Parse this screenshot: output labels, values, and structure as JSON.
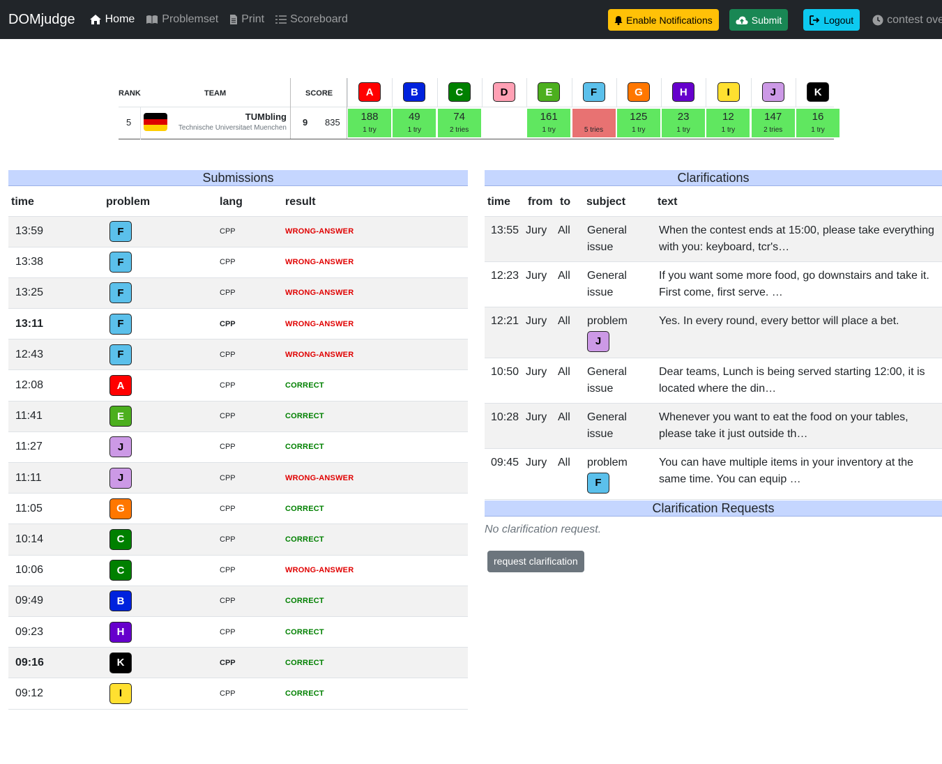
{
  "nav": {
    "brand": "DOMjudge",
    "home": "Home",
    "problemset": "Problemset",
    "print": "Print",
    "scoreboard": "Scoreboard",
    "enable_notifications": "Enable Notifications",
    "submit": "Submit",
    "logout": "Logout",
    "contest_status": "contest over"
  },
  "scoreboard": {
    "headers": {
      "rank": "RANK",
      "team": "TEAM",
      "score": "SCORE"
    },
    "problems": [
      {
        "label": "A",
        "color": "#ff0000",
        "text": "#ffffff"
      },
      {
        "label": "B",
        "color": "#0022dd",
        "text": "#ffffff"
      },
      {
        "label": "C",
        "color": "#008000",
        "text": "#ffffff"
      },
      {
        "label": "D",
        "color": "#ffa0b4",
        "text": "#000000"
      },
      {
        "label": "E",
        "color": "#4caf1e",
        "text": "#ffffff"
      },
      {
        "label": "F",
        "color": "#5bc0eb",
        "text": "#000000"
      },
      {
        "label": "G",
        "color": "#ff7700",
        "text": "#ffffff"
      },
      {
        "label": "H",
        "color": "#6600cc",
        "text": "#ffffff"
      },
      {
        "label": "I",
        "color": "#ffe030",
        "text": "#000000"
      },
      {
        "label": "J",
        "color": "#cc99e6",
        "text": "#000000"
      },
      {
        "label": "K",
        "color": "#000000",
        "text": "#ffffff"
      }
    ],
    "team": {
      "rank": "5",
      "name": "TUMbling",
      "affiliation": "Technische Universitaet Muenchen",
      "solved": "9",
      "penalty": "835",
      "results": [
        {
          "status": "solved",
          "points": "188",
          "tries": "1 try"
        },
        {
          "status": "solved",
          "points": "49",
          "tries": "1 try"
        },
        {
          "status": "solved",
          "points": "74",
          "tries": "2 tries"
        },
        {
          "status": "none",
          "points": "",
          "tries": ""
        },
        {
          "status": "solved",
          "points": "161",
          "tries": "1 try"
        },
        {
          "status": "wrong",
          "points": "",
          "tries": "5 tries"
        },
        {
          "status": "solved",
          "points": "125",
          "tries": "1 try"
        },
        {
          "status": "solved",
          "points": "23",
          "tries": "1 try"
        },
        {
          "status": "solved",
          "points": "12",
          "tries": "1 try"
        },
        {
          "status": "solved",
          "points": "147",
          "tries": "2 tries"
        },
        {
          "status": "solved",
          "points": "16",
          "tries": "1 try"
        }
      ]
    }
  },
  "submissions": {
    "title": "Submissions",
    "headers": {
      "time": "time",
      "problem": "problem",
      "lang": "lang",
      "result": "result"
    },
    "rows": [
      {
        "time": "13:59",
        "problem": "F",
        "lang": "CPP",
        "result": "WRONG-ANSWER",
        "bold": false
      },
      {
        "time": "13:38",
        "problem": "F",
        "lang": "CPP",
        "result": "WRONG-ANSWER",
        "bold": false
      },
      {
        "time": "13:25",
        "problem": "F",
        "lang": "CPP",
        "result": "WRONG-ANSWER",
        "bold": false
      },
      {
        "time": "13:11",
        "problem": "F",
        "lang": "CPP",
        "result": "WRONG-ANSWER",
        "bold": true
      },
      {
        "time": "12:43",
        "problem": "F",
        "lang": "CPP",
        "result": "WRONG-ANSWER",
        "bold": false
      },
      {
        "time": "12:08",
        "problem": "A",
        "lang": "CPP",
        "result": "CORRECT",
        "bold": false
      },
      {
        "time": "11:41",
        "problem": "E",
        "lang": "CPP",
        "result": "CORRECT",
        "bold": false
      },
      {
        "time": "11:27",
        "problem": "J",
        "lang": "CPP",
        "result": "CORRECT",
        "bold": false
      },
      {
        "time": "11:11",
        "problem": "J",
        "lang": "CPP",
        "result": "WRONG-ANSWER",
        "bold": false
      },
      {
        "time": "11:05",
        "problem": "G",
        "lang": "CPP",
        "result": "CORRECT",
        "bold": false
      },
      {
        "time": "10:14",
        "problem": "C",
        "lang": "CPP",
        "result": "CORRECT",
        "bold": false
      },
      {
        "time": "10:06",
        "problem": "C",
        "lang": "CPP",
        "result": "WRONG-ANSWER",
        "bold": false
      },
      {
        "time": "09:49",
        "problem": "B",
        "lang": "CPP",
        "result": "CORRECT",
        "bold": false
      },
      {
        "time": "09:23",
        "problem": "H",
        "lang": "CPP",
        "result": "CORRECT",
        "bold": false
      },
      {
        "time": "09:16",
        "problem": "K",
        "lang": "CPP",
        "result": "CORRECT",
        "bold": true
      },
      {
        "time": "09:12",
        "problem": "I",
        "lang": "CPP",
        "result": "CORRECT",
        "bold": false
      }
    ]
  },
  "clarifications": {
    "title": "Clarifications",
    "headers": {
      "time": "time",
      "from": "from",
      "to": "to",
      "subject": "subject",
      "text": "text"
    },
    "rows": [
      {
        "time": "13:55",
        "from": "Jury",
        "to": "All",
        "subject": "General issue",
        "problem": "",
        "text": "When the contest ends at 15:00, please take everything with you: keyboard, tcr's…"
      },
      {
        "time": "12:23",
        "from": "Jury",
        "to": "All",
        "subject": "General issue",
        "problem": "",
        "text": "If you want some more food, go downstairs and take it. First come, first serve. …"
      },
      {
        "time": "12:21",
        "from": "Jury",
        "to": "All",
        "subject": "problem",
        "problem": "J",
        "text": "Yes. In every round, every bettor will place a bet."
      },
      {
        "time": "10:50",
        "from": "Jury",
        "to": "All",
        "subject": "General issue",
        "problem": "",
        "text": "Dear teams, Lunch is being served starting 12:00, it is located where the din…"
      },
      {
        "time": "10:28",
        "from": "Jury",
        "to": "All",
        "subject": "General issue",
        "problem": "",
        "text": "Whenever you want to eat the food on your tables, please take it just outside th…"
      },
      {
        "time": "09:45",
        "from": "Jury",
        "to": "All",
        "subject": "problem",
        "problem": "F",
        "text": "You can have multiple items in your inventory at the same time. You can equip …"
      }
    ]
  },
  "clarification_requests": {
    "title": "Clarification Requests",
    "empty_text": "No clarification request.",
    "button": "request clarification"
  }
}
